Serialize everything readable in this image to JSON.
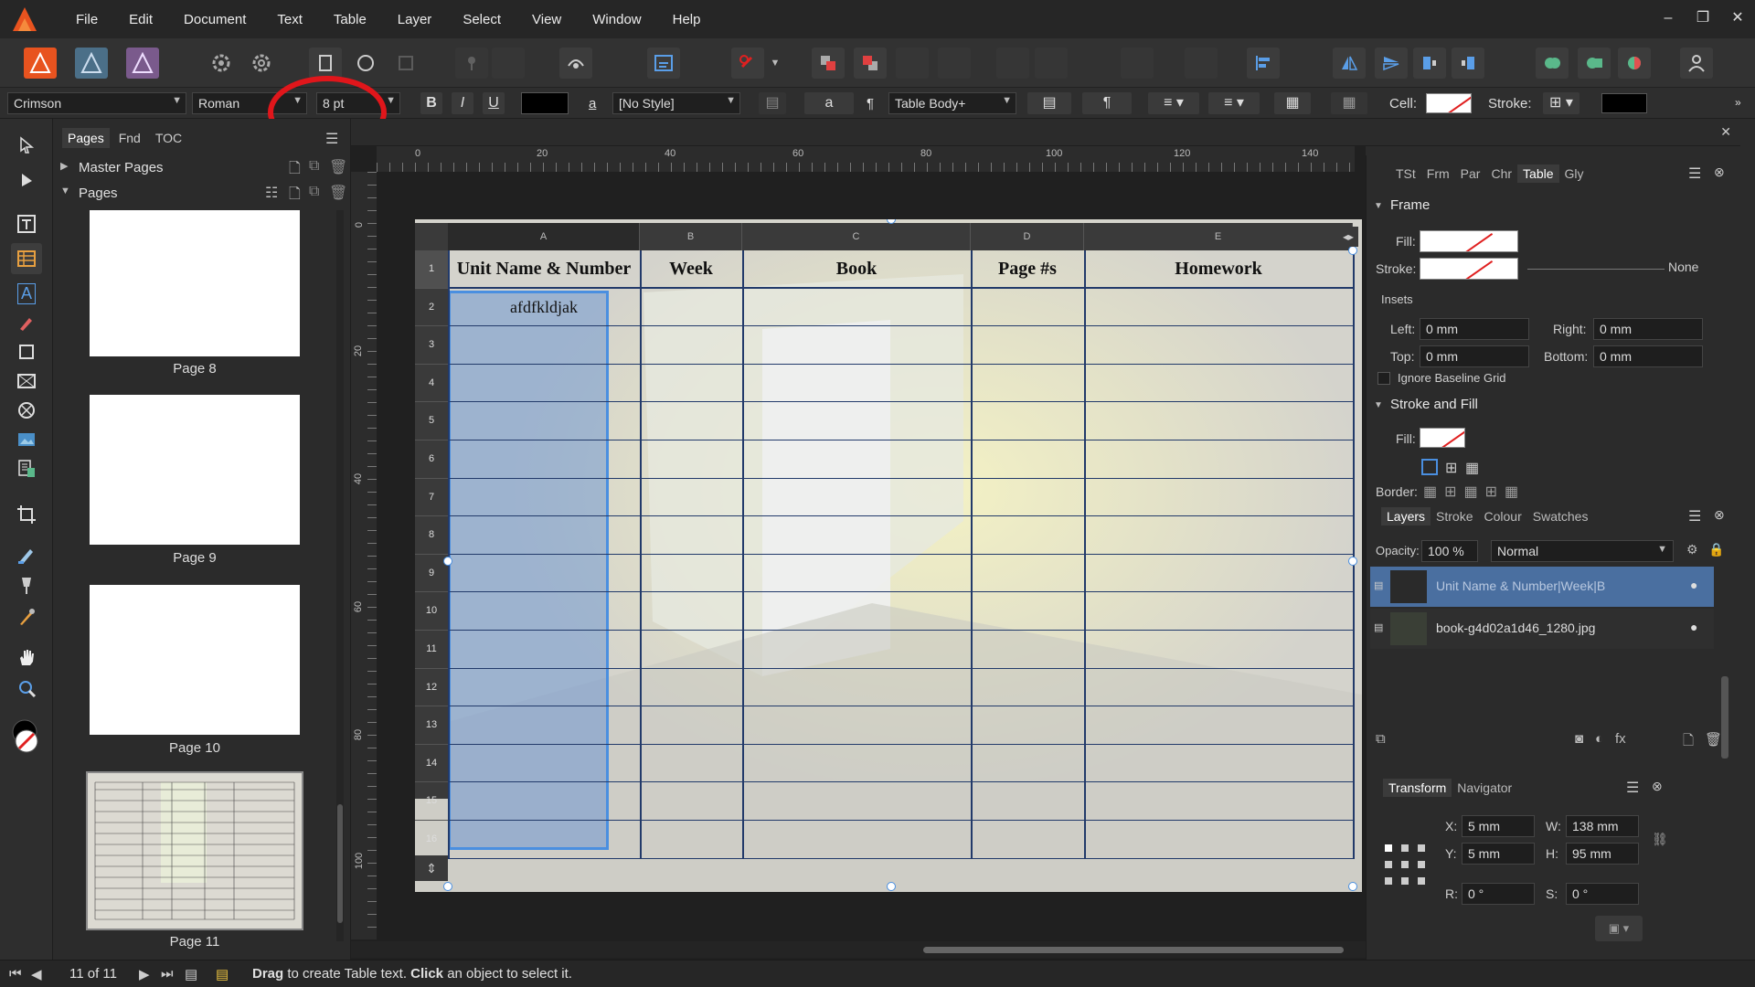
{
  "menubar": {
    "items": [
      "File",
      "Edit",
      "Document",
      "Text",
      "Table",
      "Layer",
      "Select",
      "View",
      "Window",
      "Help"
    ]
  },
  "context_toolbar": {
    "font_family": "Crimson",
    "font_style": "Roman",
    "font_size": "8 pt",
    "char_style": "[No Style]",
    "para_style": "Table Body+",
    "cell_label": "Cell:",
    "stroke_label": "Stroke:",
    "bold": "B",
    "italic": "I",
    "underline": "U",
    "char_a": "a",
    "pilcrow": "¶"
  },
  "pages_panel": {
    "tabs": [
      "Pages",
      "Fnd",
      "TOC"
    ],
    "master_pages_label": "Master Pages",
    "pages_label": "Pages",
    "pages": [
      {
        "label": "Page 8"
      },
      {
        "label": "Page 9"
      },
      {
        "label": "Page 10"
      },
      {
        "label": "Page 11"
      }
    ]
  },
  "rulers": {
    "top": [
      "0",
      "20",
      "40",
      "60",
      "80",
      "100",
      "120",
      "140"
    ],
    "left": [
      "0",
      "20",
      "40",
      "60",
      "80",
      "100"
    ]
  },
  "table": {
    "column_letters": [
      "A",
      "B",
      "C",
      "D",
      "E"
    ],
    "headers": [
      "Unit Name & Number",
      "Week",
      "Book",
      "Page #s",
      "Homework"
    ],
    "row_numbers": [
      "1",
      "2",
      "3",
      "4",
      "5",
      "6",
      "7",
      "8",
      "9",
      "10",
      "11",
      "12",
      "13",
      "14",
      "15",
      "16"
    ],
    "cell_a2": "afdfkldjak"
  },
  "right_panel": {
    "studio_tabs": [
      "TSt",
      "Frm",
      "Par",
      "Chr",
      "Table",
      "Gly"
    ],
    "active_tab": "Table",
    "frame": {
      "title": "Frame",
      "fill_label": "Fill:",
      "stroke_label": "Stroke:",
      "stroke_value": "None",
      "insets_label": "Insets",
      "left_label": "Left:",
      "left_value": "0 mm",
      "right_label": "Right:",
      "right_value": "0 mm",
      "top_label": "Top:",
      "top_value": "0 mm",
      "bottom_label": "Bottom:",
      "bottom_value": "0 mm",
      "ignore_baseline": "Ignore Baseline Grid"
    },
    "stroke_fill": {
      "title": "Stroke and Fill",
      "fill_label": "Fill:",
      "border_label": "Border:"
    },
    "layers": {
      "tabs": [
        "Layers",
        "Stroke",
        "Colour",
        "Swatches"
      ],
      "opacity_label": "Opacity:",
      "opacity_value": "100 %",
      "blend_mode": "Normal",
      "items": [
        {
          "name": "Unit Name & Number|Week|B",
          "selected": true
        },
        {
          "name": "book-g4d02a1d46_1280.jpg",
          "selected": false
        }
      ]
    },
    "transform": {
      "tabs": [
        "Transform",
        "Navigator"
      ],
      "x_label": "X:",
      "x_value": "5 mm",
      "y_label": "Y:",
      "y_value": "5 mm",
      "w_label": "W:",
      "w_value": "138 mm",
      "h_label": "H:",
      "h_value": "95 mm",
      "r_label": "R:",
      "r_value": "0 °",
      "s_label": "S:",
      "s_value": "0 °"
    }
  },
  "status": {
    "page_counter": "11 of 11",
    "hint_drag": "Drag",
    "hint_mid": " to create Table text. ",
    "hint_click": "Click",
    "hint_end": " an object to select it."
  },
  "colors": {
    "accent_blue": "#4a8fe0",
    "annotation_red": "#e0161b",
    "app_orange": "#e8531f"
  }
}
